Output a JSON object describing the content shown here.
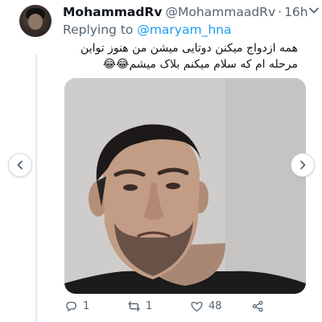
{
  "tweet": {
    "display_name": "MohammadRv",
    "handle": "@MohammaadRv",
    "separator": "·",
    "time": "16h",
    "reply_prefix": "Replying to",
    "reply_to": "@maryam_hna",
    "text_line1": "همه ازدواج میکنن دوتایی میشن من هنوز تواین",
    "text_line2": "مرحله ام که سلام میکنم بلاک میشم😂😂"
  },
  "actions": {
    "reply_count": "1",
    "retweet_count": "1",
    "like_count": "48"
  },
  "icons": {
    "menu": "chevron-down-icon",
    "reply": "reply-icon",
    "retweet": "retweet-icon",
    "like": "heart-icon",
    "share": "share-icon",
    "prev": "chevron-left-icon",
    "next": "chevron-right-icon"
  },
  "colors": {
    "link": "#1d9bf0",
    "secondary_text": "#536471",
    "primary_text": "#0f1419"
  }
}
